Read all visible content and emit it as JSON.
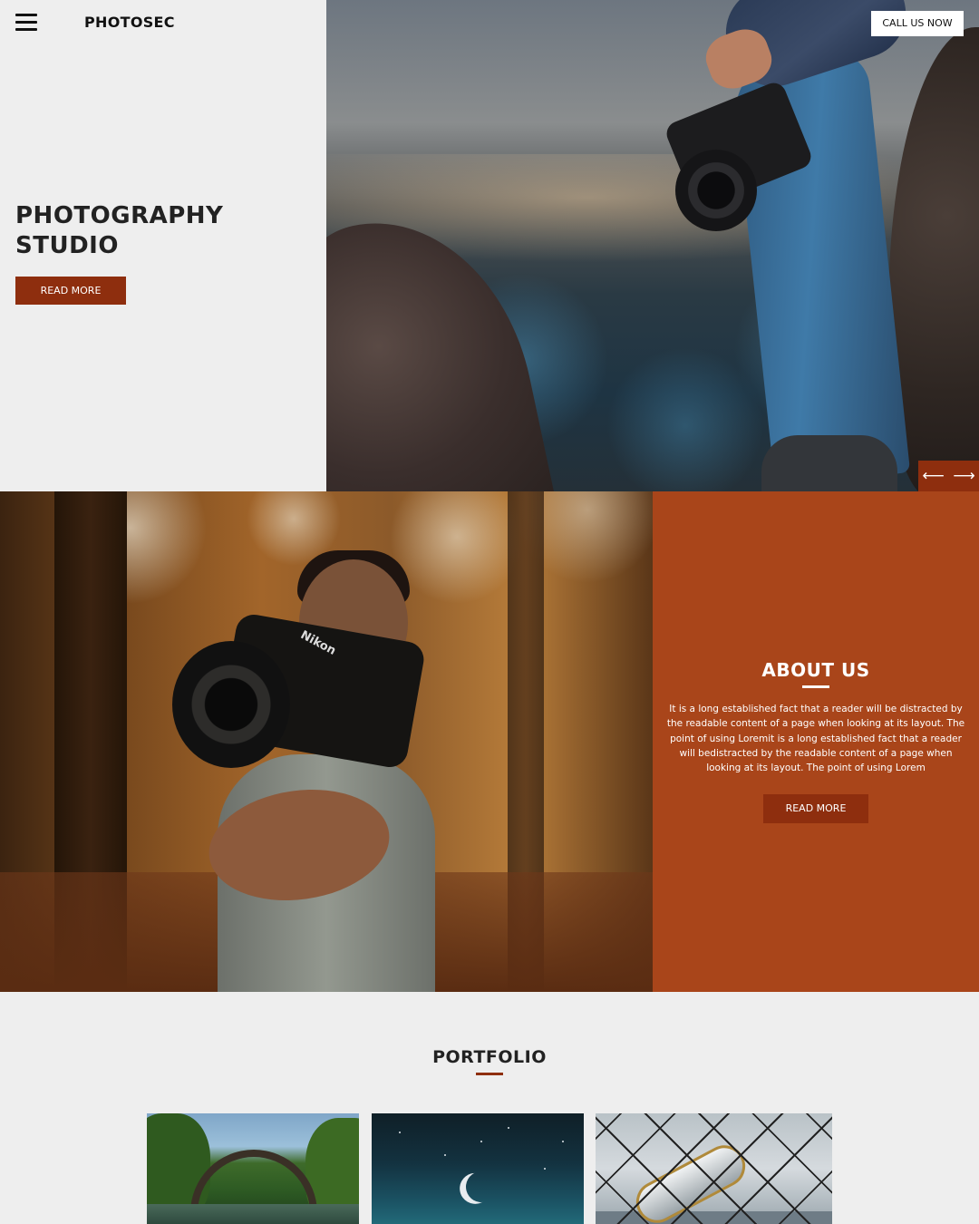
{
  "header": {
    "brand": "PHOTOSEC",
    "call_button": "CALL US NOW"
  },
  "hero": {
    "title_line1": "PHOTOGRAPHY",
    "title_line2": "STUDIO",
    "read_more": "READ MORE",
    "prev_arrow": "⟵",
    "next_arrow": "⟶"
  },
  "about": {
    "title": "ABOUT US",
    "text": "It is a long established fact that a reader will be distracted by the readable content of a page when looking at its layout. The point of using Loremit is a long established fact that a reader will bedistracted by the readable content of a page when looking at its layout. The point of using Lorem",
    "read_more": "READ MORE",
    "camera_brand": "Nikon"
  },
  "portfolio": {
    "title": "PORTFOLIO"
  },
  "colors": {
    "accent_dark": "#8e2e0e",
    "accent_panel": "#a9451a",
    "background": "#eeeeee"
  },
  "icons": {
    "menu": "hamburger-menu-icon",
    "prev": "arrow-left-icon",
    "next": "arrow-right-icon"
  }
}
